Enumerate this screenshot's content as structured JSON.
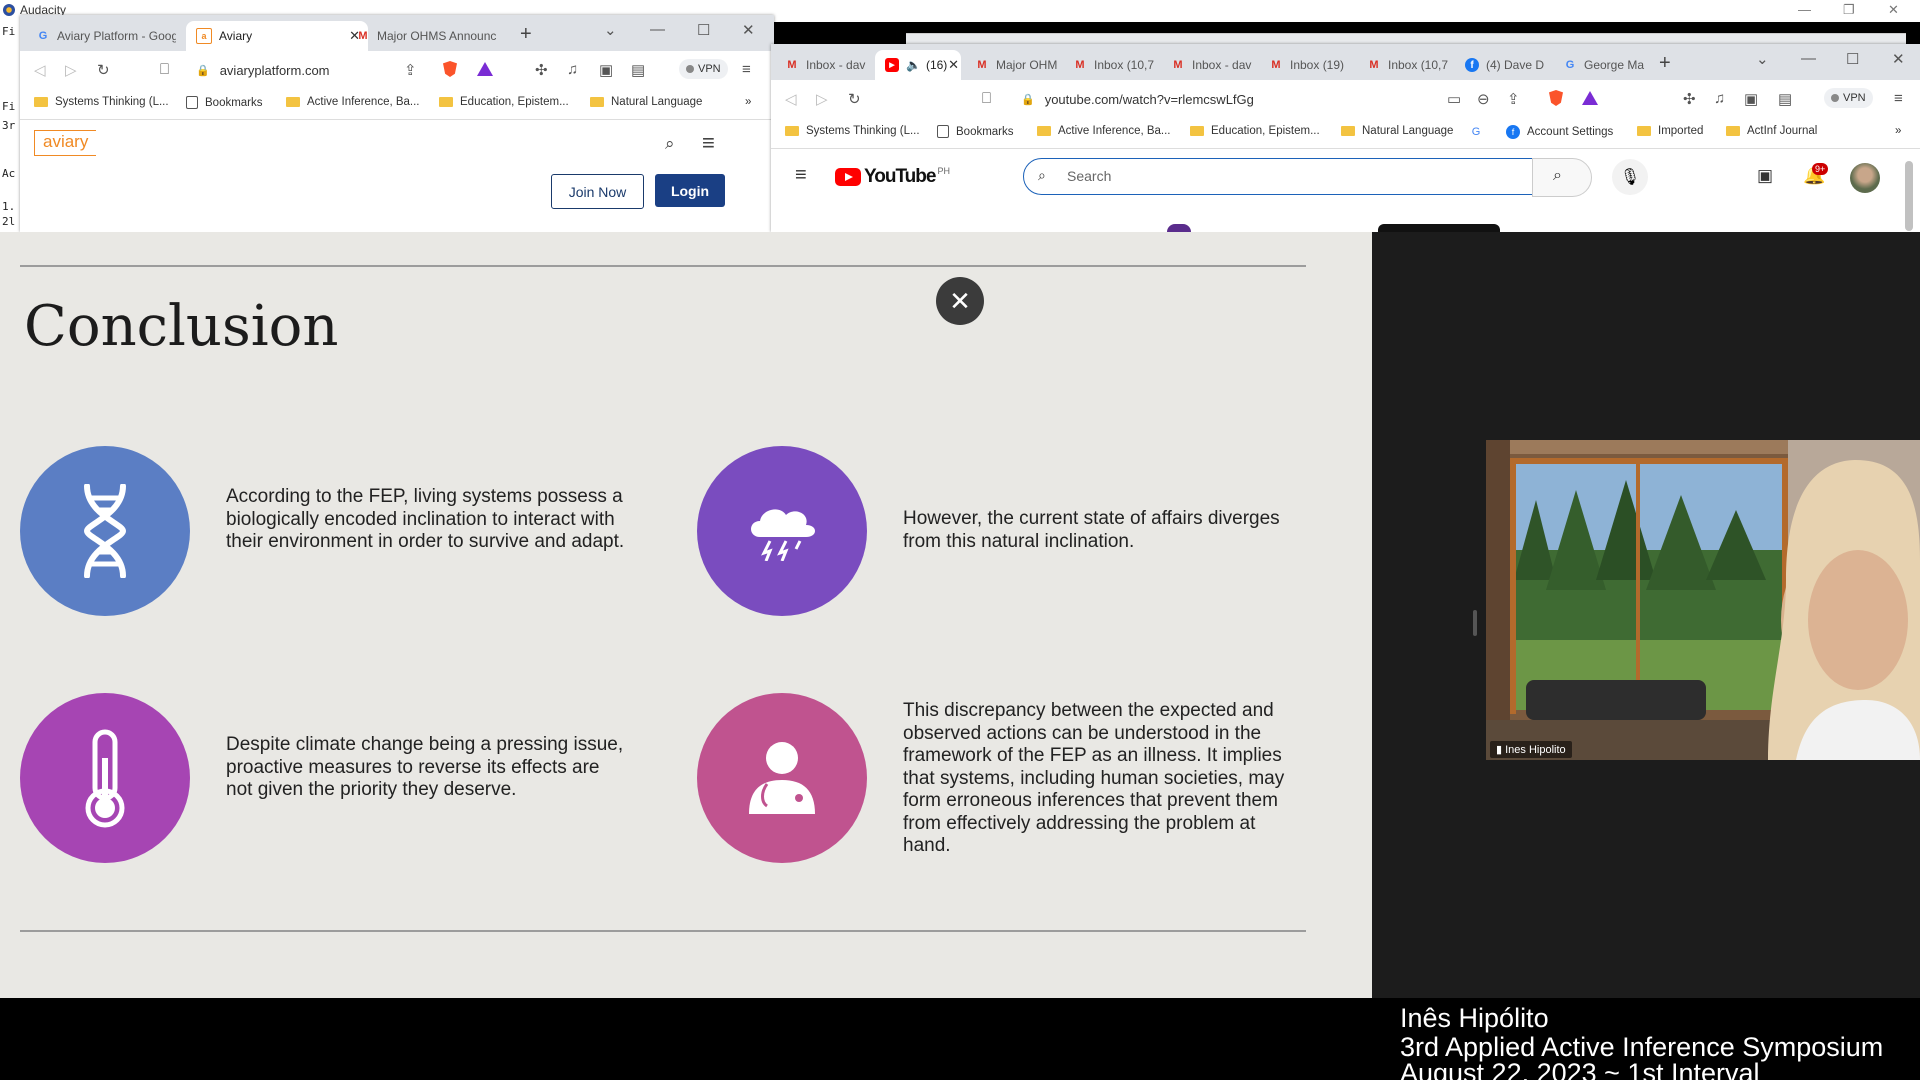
{
  "audacity": {
    "title": "Audacity"
  },
  "audacity_left": {
    "lines": [
      "Fi",
      "3r",
      "Ac",
      "1.",
      "2l",
      "Fi"
    ]
  },
  "aviary_window": {
    "tabs": [
      {
        "label": "Aviary Platform - Goog",
        "icon": "google-icon"
      },
      {
        "label": "Aviary",
        "icon": "aviary-icon"
      },
      {
        "label": "Major OHMS Announc",
        "icon": "gmail-icon"
      }
    ],
    "address": "aviaryplatform.com",
    "vpn_label": "VPN",
    "bookmarks": [
      "Systems Thinking (L...",
      "Bookmarks",
      "Active Inference, Ba...",
      "Education, Epistem...",
      "Natural Language"
    ],
    "logo": "aviary",
    "join_label": "Join Now",
    "login_label": "Login"
  },
  "youtube_window": {
    "tabs": [
      "Inbox - dav",
      "(16)",
      "Major OHM",
      "Inbox (10,7",
      "Inbox - dav",
      "Inbox (19)",
      "Inbox (10,7",
      "(4) Dave D",
      "George Ma"
    ],
    "address": "youtube.com/watch?v=rlemcswLfGg",
    "vpn_label": "VPN",
    "bookmarks": [
      "Systems Thinking (L...",
      "Bookmarks",
      "Active Inference, Ba...",
      "Education, Epistem...",
      "Natural Language",
      "Account Settings",
      "Imported",
      "ActInf Journal"
    ],
    "logo_text": "YouTube",
    "region": "PH",
    "search_placeholder": "Search",
    "notification_count": "9+"
  },
  "slide": {
    "title": "Conclusion",
    "close_symbol": "✕",
    "points": [
      {
        "text": "According to the FEP, living systems possess a biologically encoded inclination to interact with their environment in order to survive and adapt.",
        "icon": "dna-icon",
        "color": "#5b7ec4"
      },
      {
        "text": "However, the current state of affairs diverges from this natural inclination.",
        "icon": "storm-cloud-icon",
        "color": "#7a4cbf"
      },
      {
        "text": "Despite climate change being a pressing issue, proactive measures to reverse its effects are not given the priority they deserve.",
        "icon": "thermometer-icon",
        "color": "#a645b3"
      },
      {
        "text": "This discrepancy between the expected and observed actions can be understood in the framework of the FEP as an illness. It implies that systems, including human societies, may form erroneous inferences that prevent them from effectively addressing the problem at hand.",
        "icon": "doctor-icon",
        "color": "#c0538f"
      }
    ]
  },
  "video": {
    "participant_name": "Ines Hipolito",
    "caption_name": "Inês Hipólito",
    "caption_event": "3rd Applied Active Inference Symposium",
    "caption_date": "August 22, 2023 ~ 1st Interval"
  }
}
